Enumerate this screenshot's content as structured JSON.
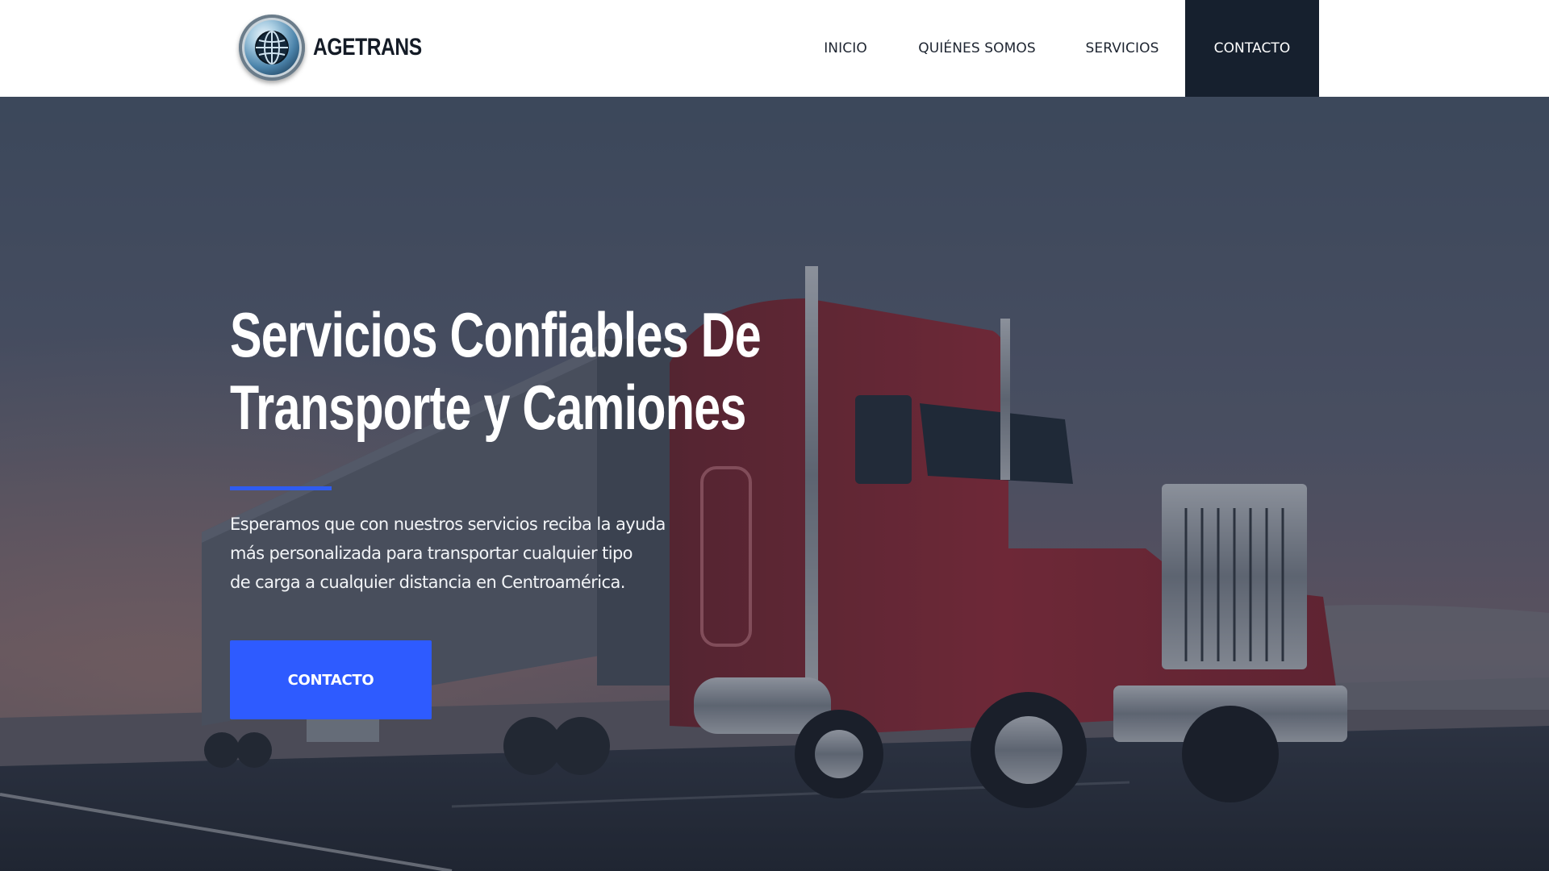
{
  "brand": {
    "name": "AGETRANS",
    "logo_icon": "globe-icon"
  },
  "nav": {
    "items": [
      {
        "label": "INICIO",
        "active": false
      },
      {
        "label": "QUIÉNES SOMOS",
        "active": false
      },
      {
        "label": "SERVICIOS",
        "active": false
      },
      {
        "label": "CONTACTO",
        "active": true
      }
    ]
  },
  "hero": {
    "title_lines": [
      "Servicios Confiables De",
      "Transporte y Camiones"
    ],
    "description_lines": [
      "Esperamos que con nuestros servicios reciba la ayuda",
      "más personalizada para transportar cualquier tipo",
      "de carga a cualquier distancia en Centroamérica."
    ],
    "cta_label": "CONTACTO",
    "background_image": "red-semi-truck-on-highway"
  },
  "colors": {
    "header_bg": "#ffffff",
    "nav_active_bg": "#16202e",
    "accent_blue": "#2e5bff",
    "divider_blue": "#2f5cf0"
  }
}
